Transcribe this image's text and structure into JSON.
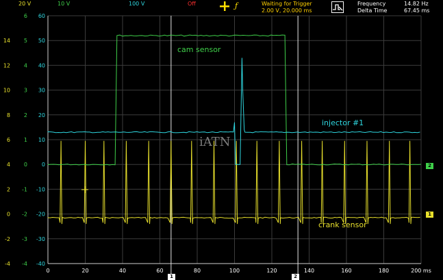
{
  "toolbar": {
    "ch_a_range": "20 V",
    "ch_b_range": "10 V",
    "ch_c_range": "100 V",
    "ch_d_range": "Off",
    "trigger_status": "Waiting for Trigger",
    "trigger_level": "2.00 V,",
    "trigger_time": "20.000 ms",
    "meas_labels": [
      "Frequency",
      "Delta Time"
    ],
    "meas_values": [
      "14.82 Hz",
      "67.45 ms"
    ],
    "icons": [
      "crosshair-icon",
      "trigger-f-icon",
      "measure-waveform-icon"
    ]
  },
  "colors": {
    "yellow": "#e8e02c",
    "green": "#3fd04a",
    "cyan": "#2fd7e0",
    "red": "#ff3030",
    "grid": "#3c3c3c",
    "axis": "#d0d0d0"
  },
  "axes": {
    "yellow_ticks": [
      "14",
      "12",
      "10",
      "8",
      "6",
      "4",
      "2",
      "0",
      "-2",
      "-4"
    ],
    "green_ticks": [
      "6",
      "5",
      "4",
      "3",
      "2",
      "1",
      "0",
      "-1",
      "-2",
      "-3",
      "-4"
    ],
    "cyan_ticks": [
      "60",
      "50",
      "40",
      "30",
      "20",
      "10",
      "0",
      "-10",
      "-20",
      "-30",
      "-40"
    ],
    "x_ticks": [
      "0",
      "20",
      "40",
      "60",
      "80",
      "100",
      "120",
      "140",
      "160",
      "180"
    ],
    "x_last": "200 ms"
  },
  "traces": {
    "cam_label": "cam sensor",
    "injector_label": "injector #1",
    "crank_label": "crank sensor",
    "watermark": "iATN"
  },
  "markers": {
    "ch2": "2",
    "ch1": "1",
    "ruler1": "1",
    "ruler2": "2"
  },
  "crank": {
    "pulse_times_ms": [
      7,
      20,
      30,
      42,
      54,
      66,
      77,
      89,
      101,
      112,
      124,
      136,
      147,
      159,
      171,
      183,
      194
    ],
    "baseline_v": -0.3,
    "peak_v": 5.9
  },
  "cam": {
    "low_v": 0.0,
    "high_v": 5.2,
    "rise_ms": 37,
    "fall_ms": 128
  },
  "injector": {
    "baseline_v": 13,
    "peak_v": 43,
    "event_ms": 104
  },
  "rulers": {
    "time_ms": [
      66,
      134
    ]
  }
}
